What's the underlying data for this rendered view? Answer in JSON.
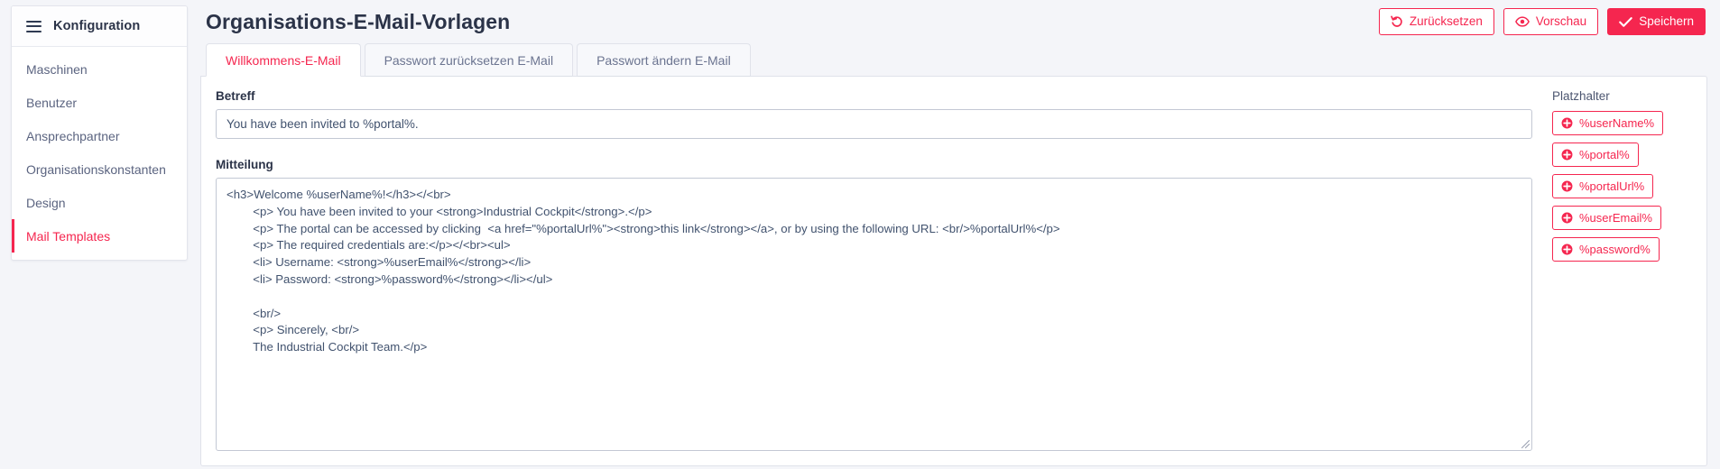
{
  "sidebar": {
    "menu_icon": "hamburger-icon",
    "title": "Konfiguration",
    "items": [
      {
        "label": "Maschinen",
        "active": false
      },
      {
        "label": "Benutzer",
        "active": false
      },
      {
        "label": "Ansprechpartner",
        "active": false
      },
      {
        "label": "Organisationskonstanten",
        "active": false
      },
      {
        "label": "Design",
        "active": false
      },
      {
        "label": "Mail Templates",
        "active": true
      }
    ]
  },
  "header": {
    "title": "Organisations-E-Mail-Vorlagen",
    "actions": [
      {
        "label": "Zurücksetzen",
        "icon": "undo-icon",
        "style": "outline"
      },
      {
        "label": "Vorschau",
        "icon": "eye-icon",
        "style": "outline"
      },
      {
        "label": "Speichern",
        "icon": "check-icon",
        "style": "primary"
      }
    ]
  },
  "tabs": [
    {
      "label": "Willkommens-E-Mail",
      "active": true
    },
    {
      "label": "Passwort zurücksetzen E-Mail",
      "active": false
    },
    {
      "label": "Passwort ändern E-Mail",
      "active": false
    }
  ],
  "form": {
    "subject_label": "Betreff",
    "subject_value": "You have been invited to %portal%.",
    "subject_placeholder": "Betreff",
    "message_label": "Mitteilung",
    "message_value": "<h3>Welcome %userName%!</h3></<br>\n        <p> You have been invited to your <strong>Industrial Cockpit</strong>.</p>\n        <p> The portal can be accessed by clicking  <a href=\"%portalUrl%\"><strong>this link</strong></a>, or by using the following URL: <br/>%portalUrl%</p>\n        <p> The required credentials are:</p></<br><ul>\n        <li> Username: <strong>%userEmail%</strong></li>\n        <li> Password: <strong>%password%</strong></li></ul>\n\n        <br/>\n        <p> Sincerely, <br/>\n        The Industrial Cockpit Team.</p>",
    "message_placeholder": "Mitteilung"
  },
  "placeholders": {
    "label": "Platzhalter",
    "items": [
      {
        "label": "%userName%",
        "icon": "plus-circle-icon"
      },
      {
        "label": "%portal%",
        "icon": "plus-circle-icon"
      },
      {
        "label": "%portalUrl%",
        "icon": "plus-circle-icon"
      },
      {
        "label": "%userEmail%",
        "icon": "plus-circle-icon"
      },
      {
        "label": "%password%",
        "icon": "plus-circle-icon"
      }
    ]
  },
  "colors": {
    "accent": "#f5264f",
    "page_background": "#f4f5f9",
    "card_background": "#ffffff",
    "text_primary": "#2b3348",
    "text_muted": "#6b7490",
    "input_text": "#41526e",
    "border": "#e0e2ea"
  }
}
